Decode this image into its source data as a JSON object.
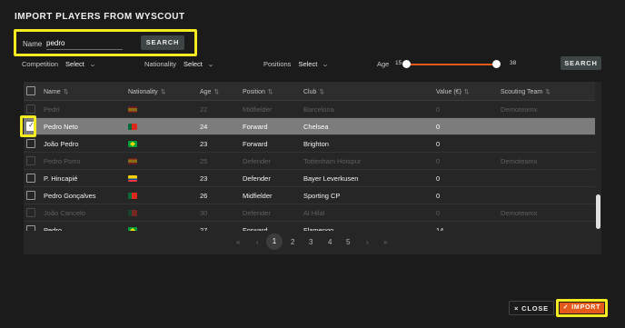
{
  "dialog": {
    "title": "IMPORT PLAYERS FROM WYSCOUT"
  },
  "search": {
    "name_label": "Name",
    "name_value": "pedro",
    "button_label": "SEARCH"
  },
  "filters": {
    "competition": {
      "label": "Competition",
      "value": "Select"
    },
    "nationality": {
      "label": "Nationality",
      "value": "Select"
    },
    "positions": {
      "label": "Positions",
      "value": "Select"
    },
    "age": {
      "label": "Age",
      "min": 15,
      "max": 38,
      "selected_min": 15,
      "selected_max": 38
    },
    "search_button_label": "SEARCH"
  },
  "table": {
    "columns": [
      "Name",
      "Nationality",
      "Age",
      "Position",
      "Club",
      "Value (€)",
      "Scouting Team"
    ],
    "rows": [
      {
        "name": "Pedri",
        "flag": "flag-spain",
        "age": "22",
        "position": "Midfielder",
        "club": "Barcelona",
        "value": "0",
        "team": "Demoteamx",
        "state": "disabled"
      },
      {
        "name": "Pedro Neto",
        "flag": "flag-portugal",
        "age": "24",
        "position": "Forward",
        "club": "Chelsea",
        "value": "0",
        "team": "",
        "state": "selected"
      },
      {
        "name": "João Pedro",
        "flag": "flag-brazil",
        "age": "23",
        "position": "Forward",
        "club": "Brighton",
        "value": "0",
        "team": "",
        "state": "enabled"
      },
      {
        "name": "Pedro Porro",
        "flag": "flag-spain",
        "age": "25",
        "position": "Defender",
        "club": "Tottenham Hotspur",
        "value": "0",
        "team": "Demoteamx",
        "state": "disabled"
      },
      {
        "name": "P. Hincapié",
        "flag": "flag-ecuador",
        "age": "23",
        "position": "Defender",
        "club": "Bayer Leverkusen",
        "value": "0",
        "team": "",
        "state": "enabled"
      },
      {
        "name": "Pedro Gonçalves",
        "flag": "flag-portugal",
        "age": "26",
        "position": "Midfielder",
        "club": "Sporting CP",
        "value": "0",
        "team": "",
        "state": "enabled"
      },
      {
        "name": "João Cancelo",
        "flag": "flag-portugal",
        "age": "30",
        "position": "Defender",
        "club": "Al Hilal",
        "value": "0",
        "team": "Demoteamx",
        "state": "disabled"
      },
      {
        "name": "Pedro",
        "flag": "flag-brazil",
        "age": "27",
        "position": "Forward",
        "club": "Flamengo",
        "value": "14",
        "team": "",
        "state": "enabled"
      }
    ]
  },
  "pagination": {
    "first": "«",
    "prev": "‹",
    "pages": [
      "1",
      "2",
      "3",
      "4",
      "5"
    ],
    "current": "1",
    "next": "›",
    "last": "»"
  },
  "footer": {
    "close_label": "CLOSE",
    "close_icon": "×",
    "import_label": "IMPORT",
    "import_icon": "✓"
  },
  "colors": {
    "accent": "#e35a1a",
    "highlight": "#f3ea1f",
    "background": "#1b1b1b"
  }
}
